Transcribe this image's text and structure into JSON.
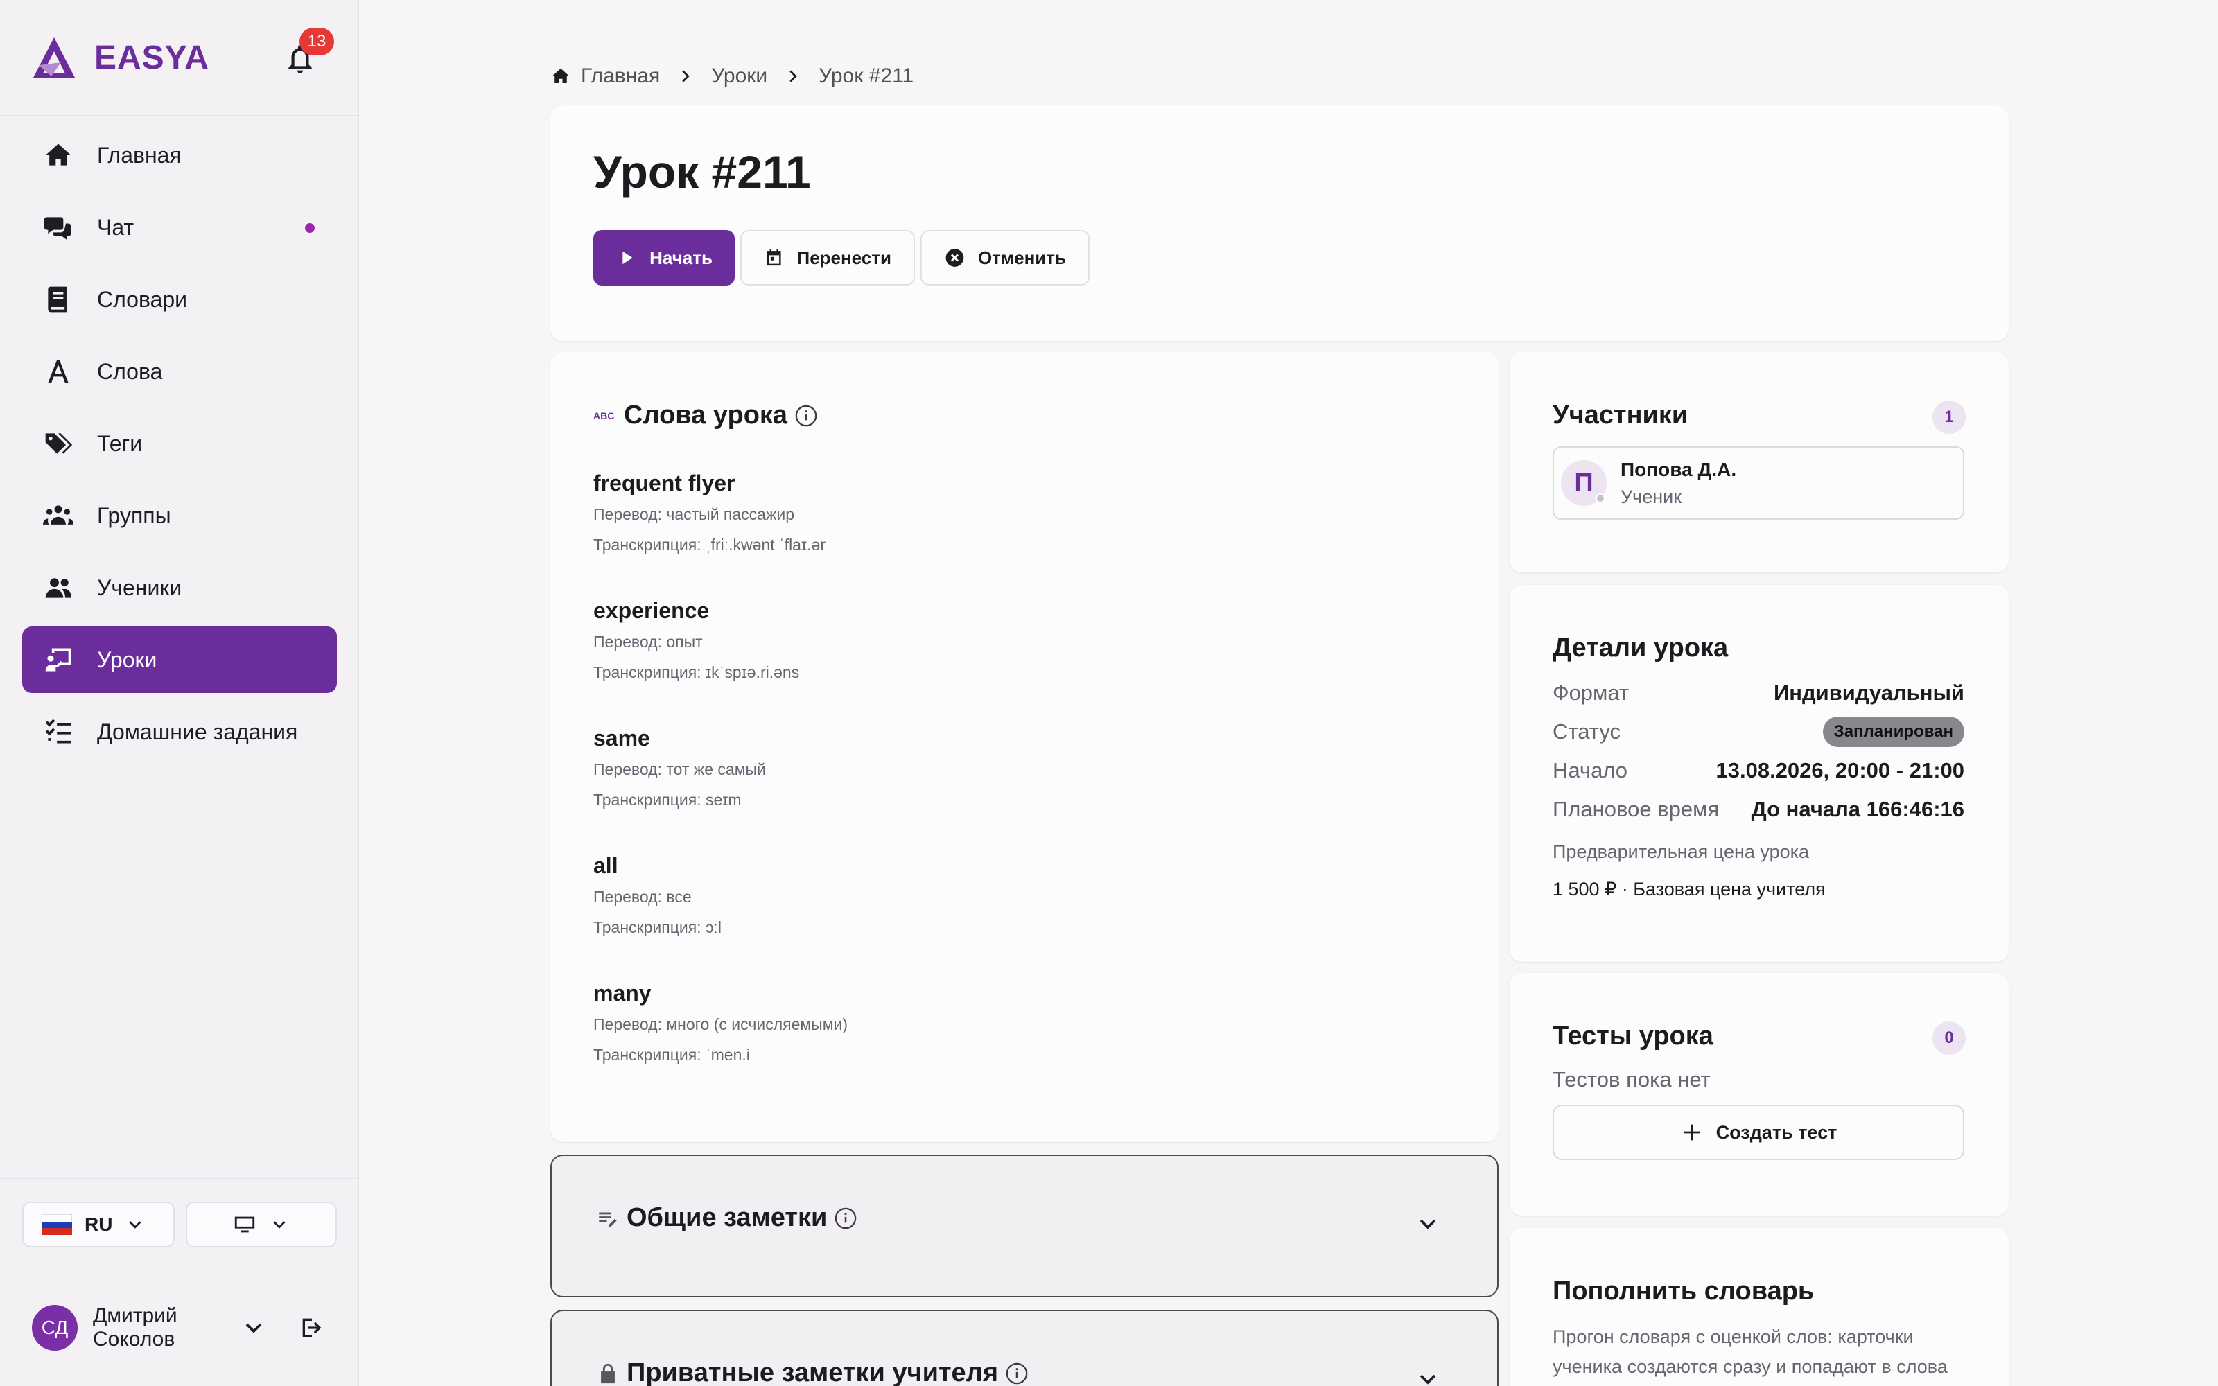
{
  "brand": {
    "name": "EASYA",
    "accent": "#6c2d9c"
  },
  "notifications": {
    "count": "13",
    "icon": "bell-icon"
  },
  "sidebar": {
    "items": [
      {
        "label": "Главная",
        "icon": "home-icon",
        "active": false
      },
      {
        "label": "Чат",
        "icon": "chat-icon",
        "active": false,
        "unread": true
      },
      {
        "label": "Словари",
        "icon": "book-icon",
        "active": false
      },
      {
        "label": "Слова",
        "icon": "letter-a-icon",
        "active": false
      },
      {
        "label": "Теги",
        "icon": "tags-icon",
        "active": false
      },
      {
        "label": "Группы",
        "icon": "groups-icon",
        "active": false
      },
      {
        "label": "Ученики",
        "icon": "students-icon",
        "active": false
      },
      {
        "label": "Уроки",
        "icon": "lesson-board-icon",
        "active": true
      },
      {
        "label": "Домашние задания",
        "icon": "checklist-icon",
        "active": false
      }
    ]
  },
  "footer": {
    "language": "RU",
    "theme_icon": "monitor-icon",
    "user": {
      "initials": "СД",
      "first_name": "Дмитрий",
      "last_name": "Соколов"
    }
  },
  "breadcrumb": [
    "Главная",
    "Уроки",
    "Урок #211"
  ],
  "lesson": {
    "title": "Урок #211",
    "actions": {
      "start": "Начать",
      "reschedule": "Перенести",
      "cancel": "Отменить"
    }
  },
  "words_section": {
    "title": "Слова урока",
    "words": [
      {
        "term": "frequent flyer",
        "translation": "Перевод: частый пассажир",
        "transcription": "Транскрипция: ˌfriː.kwənt ˈflaɪ.ər"
      },
      {
        "term": "experience",
        "translation": "Перевод: опыт",
        "transcription": "Транскрипция: ɪkˈspɪə.ri.əns"
      },
      {
        "term": "same",
        "translation": "Перевод: тот же самый",
        "transcription": "Транскрипция: seɪm"
      },
      {
        "term": "all",
        "translation": "Перевод: все",
        "transcription": "Транскрипция: ɔːl"
      },
      {
        "term": "many",
        "translation": "Перевод: много (с исчисляемыми)",
        "transcription": "Транскрипция: ˈmen.i"
      }
    ]
  },
  "general_notes": {
    "title": "Общие заметки"
  },
  "private_notes": {
    "title": "Приватные заметки учителя"
  },
  "participants": {
    "title": "Участники",
    "count": "1",
    "list": [
      {
        "initial": "П",
        "name": "Попова Д.А.",
        "role": "Ученик"
      }
    ]
  },
  "details": {
    "title": "Детали урока",
    "format_label": "Формат",
    "format_value": "Индивидуальный",
    "status_label": "Статус",
    "status_value": "Запланирован",
    "start_label": "Начало",
    "start_value": "13.08.2026, 20:00 - 21:00",
    "planned_label": "Плановое время",
    "planned_value": "До начала 166:46:16",
    "price_label": "Предварительная цена урока",
    "price_value": "1 500 ₽ · Базовая цена учителя"
  },
  "tests": {
    "title": "Тесты урока",
    "count": "0",
    "empty": "Тестов пока нет",
    "create": "Создать тест"
  },
  "dictionary": {
    "title": "Пополнить словарь",
    "description": "Прогон словаря с оценкой слов: карточки ученика создаются сразу и попадают в слова"
  }
}
